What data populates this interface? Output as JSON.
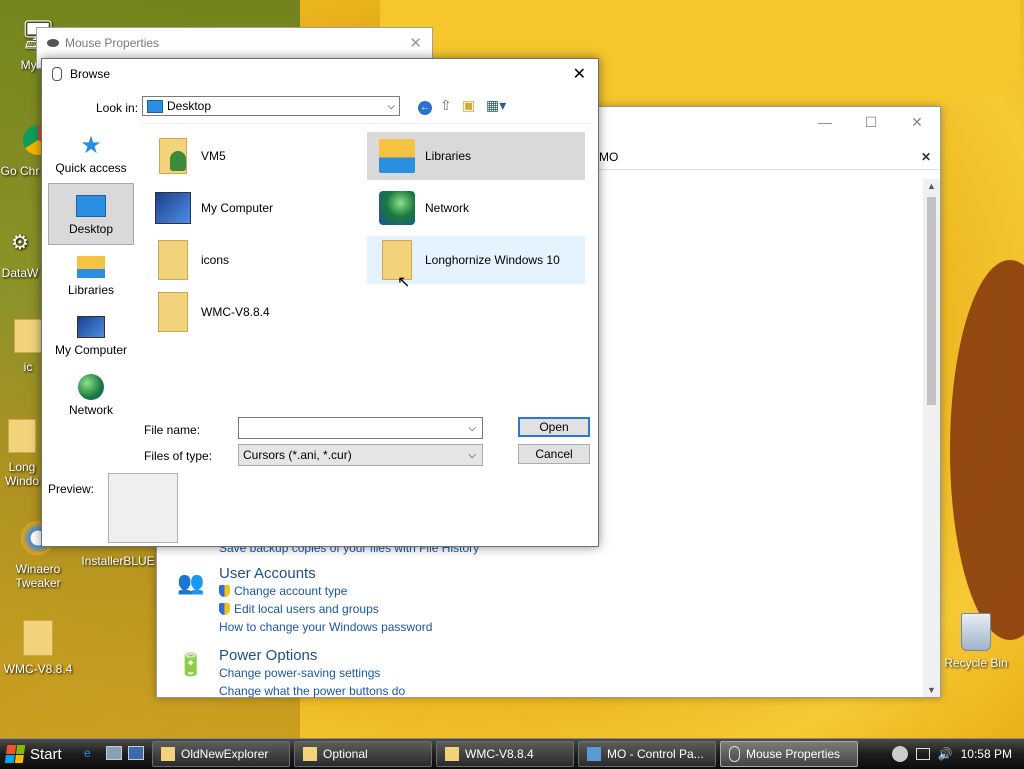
{
  "desktop": {
    "icons": [
      {
        "label": "My Co",
        "icon": "computer-icon"
      },
      {
        "label": "Go Chr",
        "icon": "chrome-icon"
      },
      {
        "label": "DataW",
        "icon": "app-icon"
      },
      {
        "label": "ic",
        "icon": "folder-icon"
      },
      {
        "label": "Long Windo",
        "icon": "folder-icon"
      },
      {
        "label": "Winaero Tweaker",
        "icon": "winaero-icon"
      },
      {
        "label": "InstallerBLUE",
        "icon": "installer-icon"
      },
      {
        "label": "WMC-V8.8.4",
        "icon": "folder-icon"
      },
      {
        "label": "Recycle Bin",
        "icon": "recycle-bin-icon"
      }
    ]
  },
  "control_panel": {
    "search_value": "MO",
    "sections": [
      {
        "links": [
          "Save backup copies of your files with File History"
        ]
      },
      {
        "heading": "User Accounts",
        "links": [
          "Change account type",
          "Edit local users and groups",
          "How to change your Windows password"
        ]
      },
      {
        "heading": "Power Options",
        "links": [
          "Change power-saving settings",
          "Change what the power buttons do"
        ]
      }
    ]
  },
  "mouse_properties": {
    "title": "Mouse Properties"
  },
  "browse": {
    "title": "Browse",
    "look_in_label": "Look in:",
    "look_in_value": "Desktop",
    "places": [
      {
        "label": "Quick access",
        "icon": "star-icon"
      },
      {
        "label": "Desktop",
        "icon": "desktop-icon",
        "selected": true
      },
      {
        "label": "Libraries",
        "icon": "libraries-icon"
      },
      {
        "label": "My Computer",
        "icon": "computer-icon"
      },
      {
        "label": "Network",
        "icon": "network-icon"
      }
    ],
    "files": [
      {
        "label": "VM5",
        "icon": "user-folder-icon"
      },
      {
        "label": "Libraries",
        "icon": "libraries-icon",
        "selected": true
      },
      {
        "label": "My Computer",
        "icon": "computer-icon"
      },
      {
        "label": "Network",
        "icon": "network-icon"
      },
      {
        "label": "icons",
        "icon": "folder-icon"
      },
      {
        "label": "Longhornize Windows 10",
        "icon": "folder-icon",
        "hover": true
      },
      {
        "label": "WMC-V8.8.4",
        "icon": "folder-icon"
      }
    ],
    "file_name_label": "File name:",
    "file_name_value": "",
    "files_of_type_label": "Files of type:",
    "files_of_type_value": "Cursors (*.ani, *.cur)",
    "open_label": "Open",
    "cancel_label": "Cancel",
    "preview_label": "Preview:"
  },
  "taskbar": {
    "start_label": "Start",
    "tasks": [
      {
        "label": "OldNewExplorer",
        "icon": "folder-icon"
      },
      {
        "label": "Optional",
        "icon": "folder-icon"
      },
      {
        "label": "WMC-V8.8.4",
        "icon": "folder-icon"
      },
      {
        "label": "MO - Control Pa...",
        "icon": "control-panel-icon"
      },
      {
        "label": "Mouse Properties",
        "icon": "mouse-icon",
        "active": true
      }
    ],
    "clock": "10:58 PM"
  }
}
